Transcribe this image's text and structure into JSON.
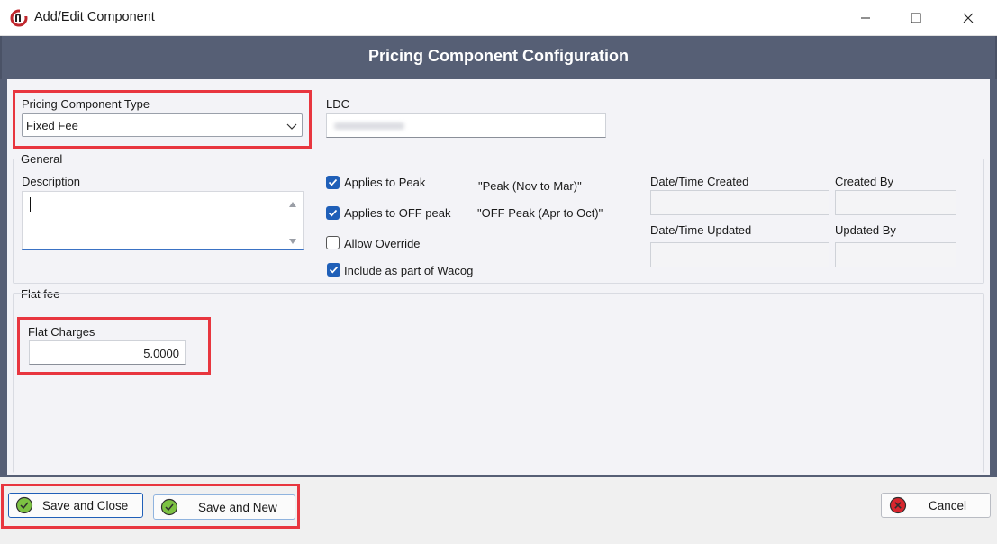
{
  "window": {
    "title": "Add/Edit Component",
    "icons": {
      "app": "app-logo-icon",
      "minimize": "minimize-icon",
      "maximize": "maximize-icon",
      "close": "close-icon"
    }
  },
  "header": {
    "title": "Pricing Component Configuration"
  },
  "pricing_type": {
    "label": "Pricing Component Type",
    "value": "Fixed Fee"
  },
  "ldc": {
    "label": "LDC",
    "value": ""
  },
  "general": {
    "legend": "General",
    "description_label": "Description",
    "description_value": "",
    "applies_peak": {
      "label": "Applies to Peak",
      "checked": true,
      "note": "\"Peak (Nov to Mar)\""
    },
    "applies_off_peak": {
      "label": "Applies to OFF peak",
      "checked": true,
      "note": "\"OFF Peak (Apr to Oct)\""
    },
    "allow_override": {
      "label": "Allow Override",
      "checked": false
    },
    "include_wacog": {
      "label": "Include as part of Wacog",
      "checked": true
    },
    "created_label": "Date/Time Created",
    "created_by_label": "Created By",
    "updated_label": "Date/Time Updated",
    "updated_by_label": "Updated By"
  },
  "flat_fee": {
    "legend": "Flat fee",
    "charges_label": "Flat Charges",
    "charges_value": "5.0000"
  },
  "footer": {
    "save_close": "Save and Close",
    "save_new": "Save and New",
    "cancel": "Cancel"
  },
  "colors": {
    "header_bg": "#565f75",
    "highlight": "#e8363f",
    "check_blue": "#1f5fb8",
    "ok_green": "#7cc242",
    "cancel_red": "#d7262d"
  }
}
